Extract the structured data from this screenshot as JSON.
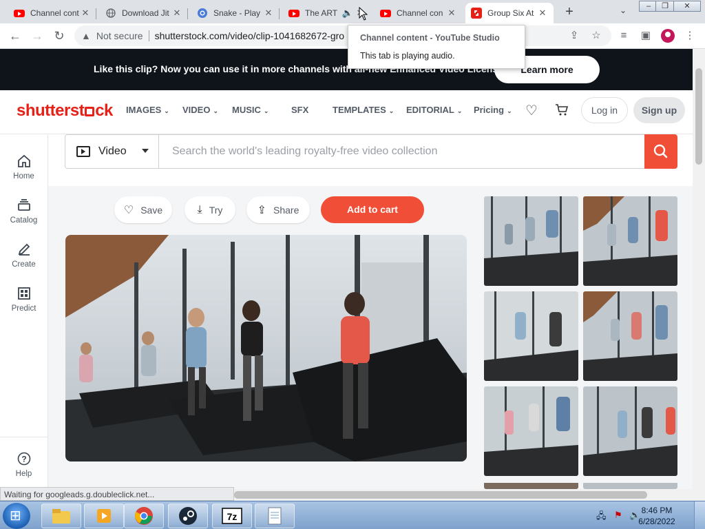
{
  "browser": {
    "tabs": [
      {
        "title": "Channel cont",
        "icon": "youtube-icon",
        "active": false
      },
      {
        "title": "Download Jit",
        "icon": "globe-icon",
        "active": false
      },
      {
        "title": "Snake - Play",
        "icon": "snake-game-icon",
        "active": false
      },
      {
        "title": "The ART",
        "icon": "youtube-icon",
        "active": false,
        "audio": true
      },
      {
        "title": "Channel con",
        "icon": "youtube-icon",
        "active": false
      },
      {
        "title": "Group Six At",
        "icon": "shutterstock-icon",
        "active": true
      }
    ],
    "address": {
      "security": "Not secure",
      "url": "shutterstock.com/video/clip-1041682672-gro"
    },
    "tooltip": {
      "title": "Channel content - YouTube Studio",
      "subtitle": "This tab is playing audio."
    },
    "status_text": "Waiting for googleads.g.doubleclick.net..."
  },
  "promo": {
    "text": "Like this clip? Now you can use it in more channels with all-new Enhanced Video Licenses.",
    "button": "Learn more"
  },
  "site": {
    "logo_part1": "shutterst",
    "logo_part2": "ck",
    "nav": [
      {
        "label": "IMAGES",
        "dropdown": true
      },
      {
        "label": "VIDEO",
        "dropdown": true
      },
      {
        "label": "MUSIC",
        "dropdown": true
      },
      {
        "label": "SFX",
        "dropdown": false
      },
      {
        "label": "TEMPLATES",
        "dropdown": true
      },
      {
        "label": "EDITORIAL",
        "dropdown": true
      },
      {
        "label": "Pricing",
        "dropdown": true
      }
    ],
    "login": "Log in",
    "signup": "Sign up"
  },
  "rail": [
    {
      "label": "Home",
      "icon": "home-icon"
    },
    {
      "label": "Catalog",
      "icon": "catalog-icon"
    },
    {
      "label": "Create",
      "icon": "create-icon"
    },
    {
      "label": "Predict",
      "icon": "predict-icon"
    },
    {
      "label": "Help",
      "icon": "help-icon"
    }
  ],
  "search": {
    "type": "Video",
    "placeholder": "Search the world's leading royalty-free video collection"
  },
  "actions": {
    "save": "Save",
    "try": "Try",
    "share": "Share",
    "add_to_cart": "Add to cart"
  },
  "taskbar": {
    "time": "8:46 PM",
    "date": "6/28/2022"
  },
  "colors": {
    "brand_red": "#e62117",
    "cart_red": "#f04e36",
    "banner_dark": "#0f141a"
  }
}
